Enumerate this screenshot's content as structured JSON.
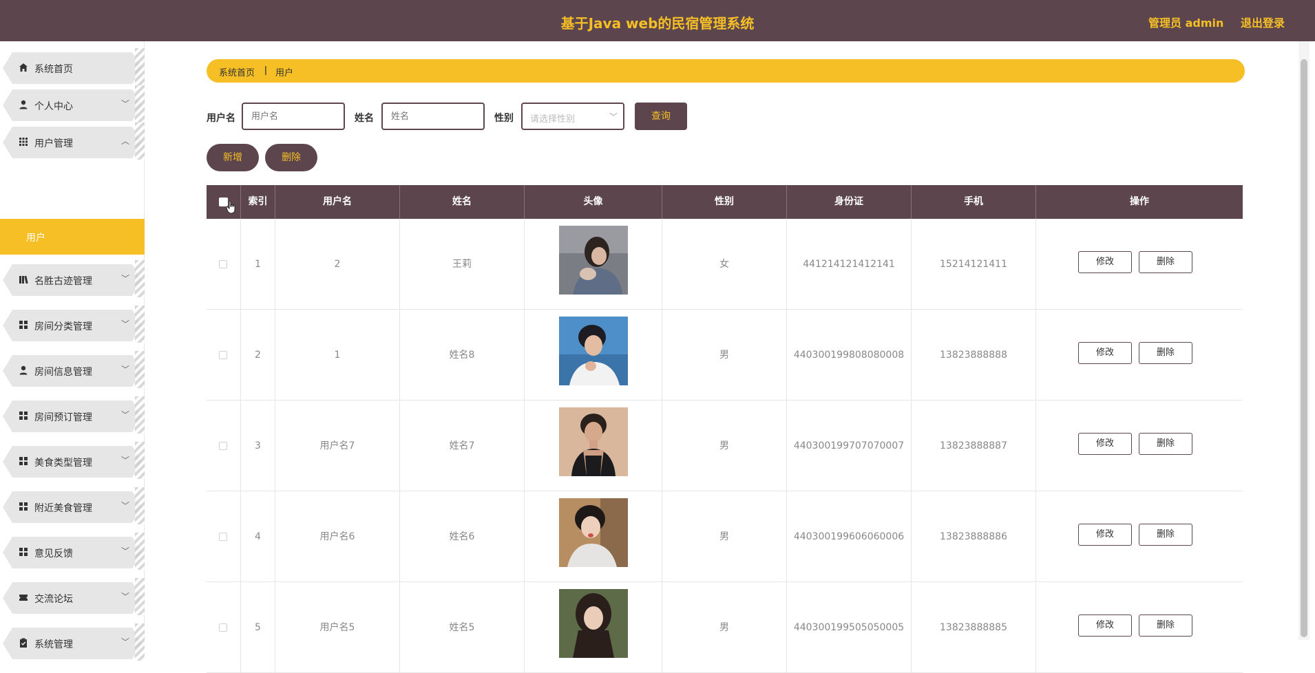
{
  "header": {
    "title": "基于Java web的民宿管理系统",
    "admin": "管理员 admin",
    "logout": "退出登录"
  },
  "sidebar": {
    "items": [
      {
        "label": "系统首页",
        "icon": "home-icon"
      },
      {
        "label": "个人中心",
        "icon": "person-icon"
      },
      {
        "label": "用户管理",
        "icon": "grid-icon"
      },
      {
        "label": "名胜古迹管理",
        "icon": "library-icon"
      },
      {
        "label": "房间分类管理",
        "icon": "apps-icon"
      },
      {
        "label": "房间信息管理",
        "icon": "person-icon"
      },
      {
        "label": "房间预订管理",
        "icon": "apps-icon"
      },
      {
        "label": "美食类型管理",
        "icon": "apps-icon"
      },
      {
        "label": "附近美食管理",
        "icon": "apps-icon"
      },
      {
        "label": "意见反馈",
        "icon": "apps-icon"
      },
      {
        "label": "交流论坛",
        "icon": "ticket-icon"
      },
      {
        "label": "系统管理",
        "icon": "clipboard-icon"
      }
    ],
    "sub_item": "用户"
  },
  "breadcrumb": {
    "home": "系统首页",
    "sep": "ǀ",
    "current": "用户"
  },
  "search": {
    "username_label": "用户名",
    "username_placeholder": "用户名",
    "name_label": "姓名",
    "name_placeholder": "姓名",
    "gender_label": "性别",
    "gender_placeholder": "请选择性别",
    "query_button": "查询"
  },
  "actions": {
    "add": "新增",
    "delete": "删除"
  },
  "table": {
    "columns": [
      "索引",
      "用户名",
      "姓名",
      "头像",
      "性别",
      "身份证",
      "手机",
      "操作"
    ],
    "rows": [
      {
        "index": "1",
        "username": "2",
        "name": "王莉",
        "gender": "女",
        "id_card": "441214121412141",
        "phone": "15214121411",
        "edit": "修改",
        "del": "删除"
      },
      {
        "index": "2",
        "username": "1",
        "name": "姓名8",
        "gender": "男",
        "id_card": "440300199808080008",
        "phone": "13823888888",
        "edit": "修改",
        "del": "删除"
      },
      {
        "index": "3",
        "username": "用户名7",
        "name": "姓名7",
        "gender": "男",
        "id_card": "440300199707070007",
        "phone": "13823888887",
        "edit": "修改",
        "del": "删除"
      },
      {
        "index": "4",
        "username": "用户名6",
        "name": "姓名6",
        "gender": "男",
        "id_card": "440300199606060006",
        "phone": "13823888886",
        "edit": "修改",
        "del": "删除"
      },
      {
        "index": "5",
        "username": "用户名5",
        "name": "姓名5",
        "gender": "男",
        "id_card": "440300199505050005",
        "phone": "13823888885",
        "edit": "修改",
        "del": "删除"
      }
    ]
  },
  "colors": {
    "primary": "#5c454d",
    "accent": "#f6bf26"
  }
}
